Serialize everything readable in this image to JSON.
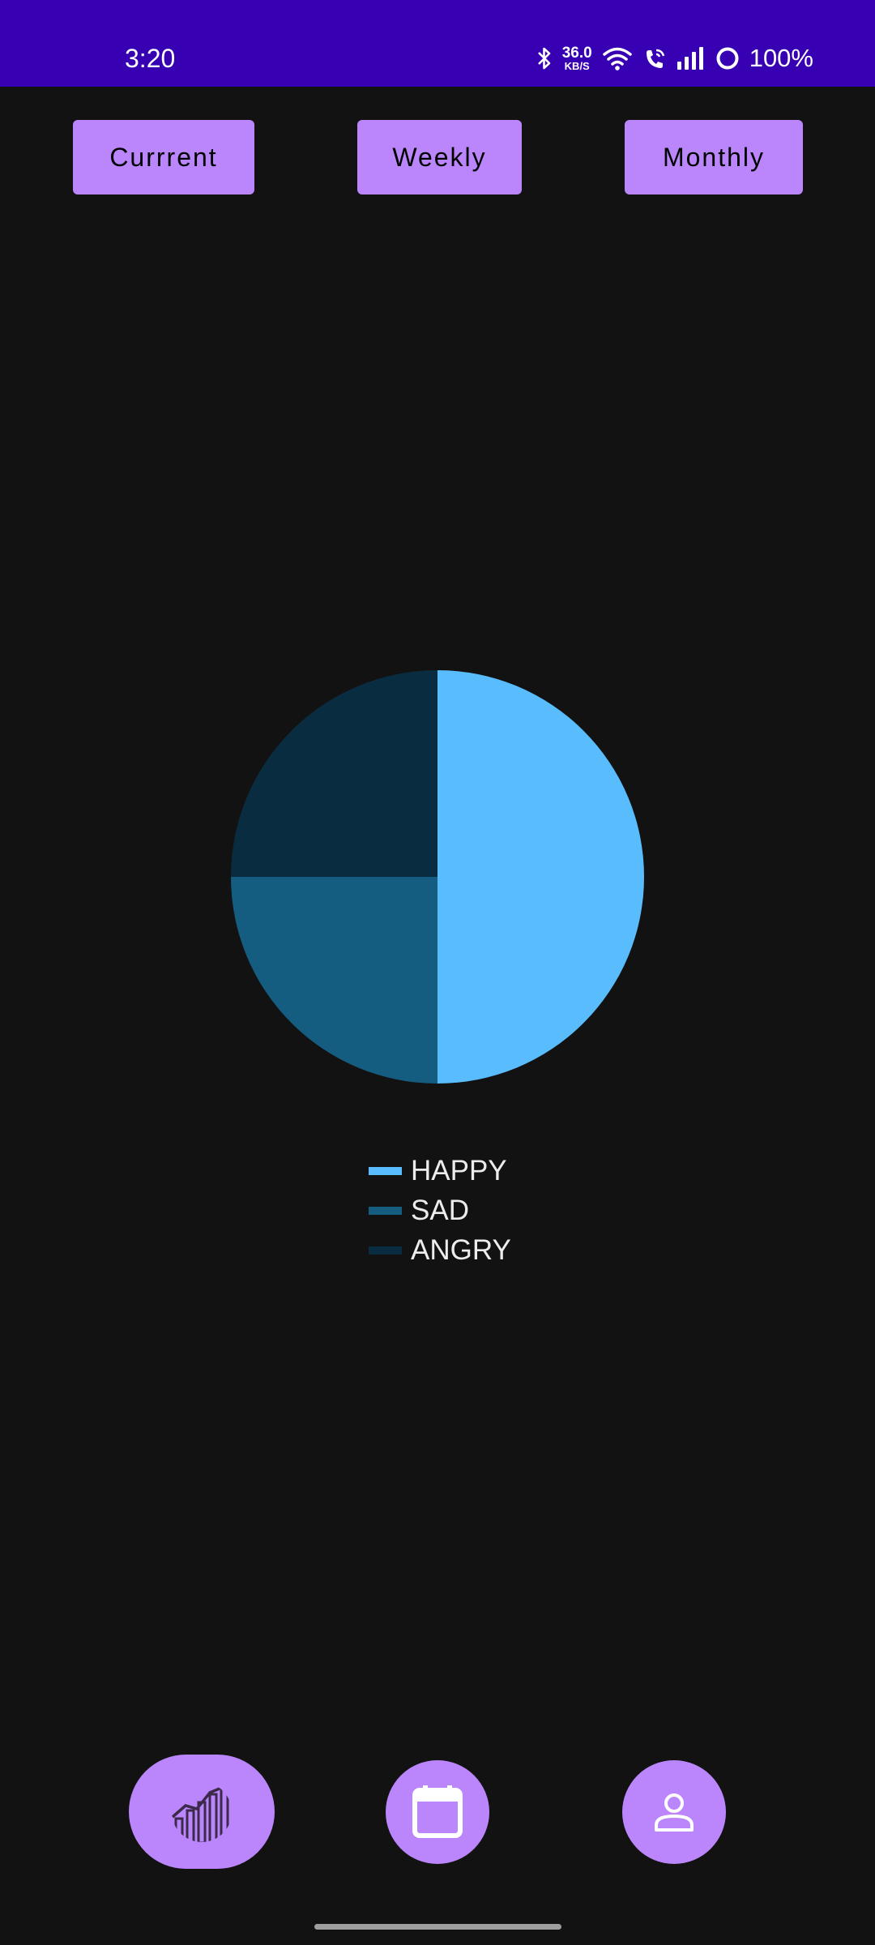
{
  "status_bar": {
    "time": "3:20",
    "net_speed_value": "36.0",
    "net_speed_unit": "KB/S",
    "battery": "100%",
    "icons": [
      "bluetooth-icon",
      "wifi-icon",
      "wifi-calling-icon",
      "signal-icon",
      "battery-ring-icon"
    ]
  },
  "toolbar": {
    "current_label": "Currrent",
    "weekly_label": "Weekly",
    "monthly_label": "Monthly"
  },
  "chart_data": {
    "type": "pie",
    "labels": [
      "HAPPY",
      "SAD",
      "ANGRY"
    ],
    "values": [
      50,
      25,
      25
    ],
    "colors": [
      "#58bcfd",
      "#155d80",
      "#0a2c41"
    ],
    "legend": "bottom"
  },
  "bottom_nav": {
    "items": [
      {
        "icon": "stats-chart-icon"
      },
      {
        "icon": "calendar-icon"
      },
      {
        "icon": "person-icon"
      }
    ]
  },
  "colors": {
    "status_bar": "#3700b3",
    "background": "#121212",
    "accent": "#bb86fc"
  }
}
